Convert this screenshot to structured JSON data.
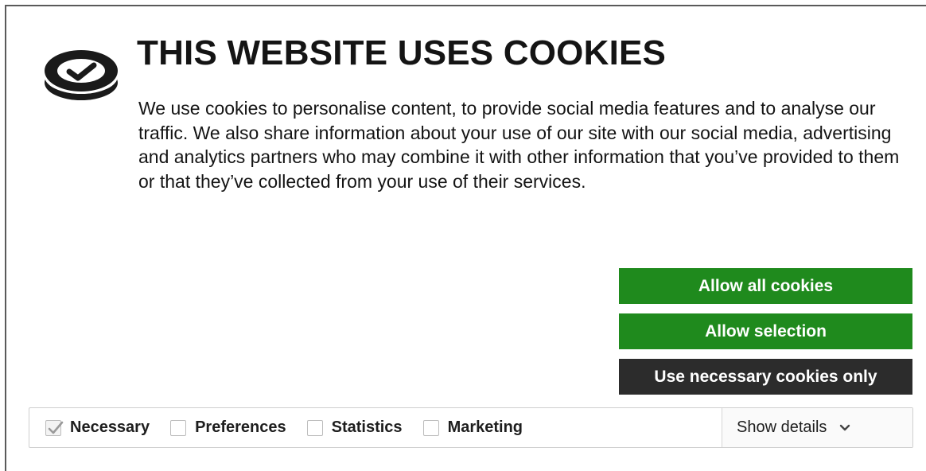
{
  "banner": {
    "title": "THIS WEBSITE USES COOKIES",
    "description": "We use cookies to personalise content, to provide social media features and to analyse our traffic. We also share information about your use of our site with our social media, advertising and analytics partners who may combine it with other information that you’ve provided to them or that they’ve collected from your use of their services.",
    "logo_icon": "cookie-check-icon"
  },
  "buttons": {
    "allow_all": "Allow all cookies",
    "allow_selection": "Allow selection",
    "necessary_only": "Use necessary cookies only"
  },
  "options": [
    {
      "label": "Necessary",
      "checked": true
    },
    {
      "label": "Preferences",
      "checked": false
    },
    {
      "label": "Statistics",
      "checked": false
    },
    {
      "label": "Marketing",
      "checked": false
    }
  ],
  "details": {
    "label": "Show details",
    "icon": "chevron-down-icon"
  },
  "colors": {
    "accent_green": "#1f8a1d",
    "dark_button": "#2c2c2c",
    "text": "#141414"
  }
}
